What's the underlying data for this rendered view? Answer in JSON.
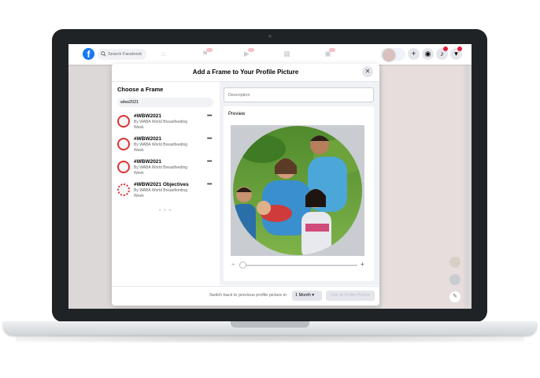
{
  "topbar": {
    "logo": "f",
    "search_placeholder": "Search Facebook",
    "icons": [
      "home-icon",
      "flag-icon",
      "watch-icon",
      "marketplace-icon",
      "groups-icon"
    ],
    "plus_label": "+",
    "badge_color": "#e41e3f"
  },
  "modal": {
    "title": "Add a Frame to Your Profile Picture",
    "close_label": "✕",
    "choose_title": "Choose a Frame",
    "search_value": "wbw2021",
    "frames": [
      {
        "name": "#WBW2021",
        "by": "By WABA World Breastfeeding Week"
      },
      {
        "name": "#WBW2021",
        "by": "By WABA World Breastfeeding Week"
      },
      {
        "name": "#WBW2021",
        "by": "By WABA World Breastfeeding Week"
      },
      {
        "name": "#WBW2021 Objectives",
        "by": "By WABA World Breastfeeding Week"
      }
    ],
    "more_label": "•••",
    "loading": "• • •",
    "description_placeholder": "Description",
    "preview_label": "Preview",
    "slider_minus": "−",
    "slider_plus": "+",
    "footer_text": "Switch back to previous profile picture in",
    "duration": "1 Month",
    "use_button": "Use as Profile Picture"
  },
  "colors": {
    "brand": "#1877f2",
    "frame_red": "#d33"
  }
}
